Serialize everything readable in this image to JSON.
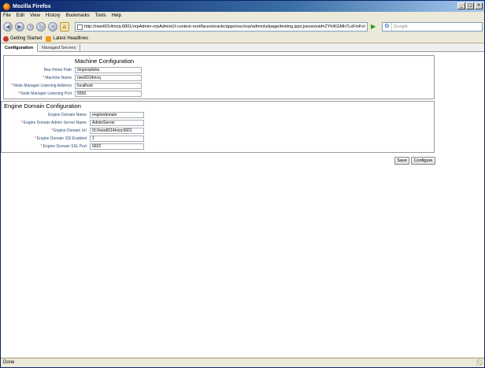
{
  "window": {
    "title": "Mozilla Firefox"
  },
  "menu": [
    "File",
    "Edit",
    "View",
    "History",
    "Bookmarks",
    "Tools",
    "Help"
  ],
  "url": "http://nwo6014mcq:6801/orpAdmin-orpAdminUI-context-root/faces/oracle/apps/osc/orp/admin/ui/page/testing.jspx;jsessionid=ZYhlKGMh7LsFmFnI",
  "search": {
    "placeholder": "Google"
  },
  "bookmarks": [
    {
      "label": "Getting Started"
    },
    {
      "label": "Latest Headlines"
    }
  ],
  "tabs": [
    {
      "label": "Configuration",
      "active": true
    },
    {
      "label": "Managed Servers",
      "active": false
    }
  ],
  "machine": {
    "title": "Machine Configuration",
    "fields": [
      {
        "label": "Bea Home Path",
        "required": false,
        "value": "/tmp/orplinks"
      },
      {
        "label": "Machine Name",
        "required": true,
        "value": "nwo6014mcq"
      },
      {
        "label": "Node Manager Listening Address",
        "required": true,
        "value": "localhost"
      },
      {
        "label": "Node Manager Listening Port",
        "required": true,
        "value": "5556"
      }
    ]
  },
  "engine": {
    "title": "Engine Domain Configuration",
    "fields": [
      {
        "label": "Engine Domain Name",
        "required": false,
        "value": "enginedomain"
      },
      {
        "label": "Engine Domain Admin Server Name",
        "required": true,
        "value": "AdminServer"
      },
      {
        "label": "Engine Domain Url",
        "required": true,
        "value": "t3://nwo6014mcq:6601"
      },
      {
        "label": "Engine Domain SSl Enabled",
        "required": true,
        "value": "1"
      },
      {
        "label": "Engine Domain SSL Port",
        "required": true,
        "value": "6602"
      }
    ]
  },
  "buttons": {
    "save": "Save",
    "configure": "Configure"
  },
  "status": "Done"
}
